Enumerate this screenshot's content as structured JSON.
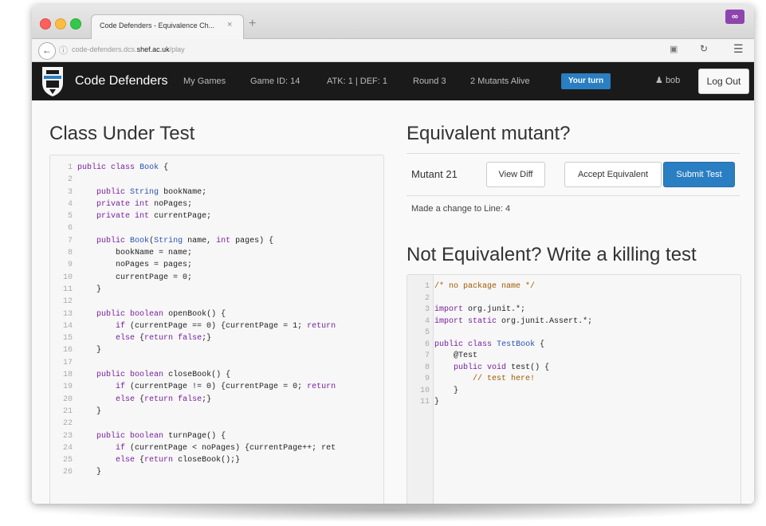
{
  "browser": {
    "tab_title": "Code Defenders - Equivalence Ch...",
    "tab_close": "×",
    "new_tab": "+",
    "ext_label": "∞",
    "url_prefix": "code-defenders.dcs.",
    "url_host": "shef.ac.uk",
    "url_path": "/play"
  },
  "navbar": {
    "brand": "Code Defenders",
    "my_games": "My Games",
    "game_id": "Game ID: 14",
    "score": "ATK: 1 | DEF: 1",
    "round": "Round 3",
    "mutants_alive": "2 Mutants Alive",
    "your_turn": "Your turn",
    "user": "bob",
    "logout": "Log Out"
  },
  "left": {
    "heading": "Class Under Test"
  },
  "right": {
    "heading": "Equivalent mutant?",
    "mutant": "Mutant 21",
    "view_diff": "View Diff",
    "accept_equivalent": "Accept Equivalent",
    "submit_test": "Submit Test",
    "change_text": "Made a change to Line: 4",
    "kill_heading": "Not Equivalent? Write a killing test"
  },
  "class_code": [
    "public class Book {",
    "",
    "    public String bookName;",
    "    private int noPages;",
    "    private int currentPage;",
    "",
    "    public Book(String name, int pages) {",
    "        bookName = name;",
    "        noPages = pages;",
    "        currentPage = 0;",
    "    }",
    "",
    "    public boolean openBook() {",
    "        if (currentPage == 0) {currentPage = 1; return",
    "        else {return false;}",
    "    }",
    "",
    "    public boolean closeBook() {",
    "        if (currentPage != 0) {currentPage = 0; return",
    "        else {return false;}",
    "    }",
    "",
    "    public boolean turnPage() {",
    "        if (currentPage < noPages) {currentPage++; ret",
    "        else {return closeBook();}",
    "    }"
  ],
  "test_code": [
    "/* no package name */",
    "",
    "import org.junit.*;",
    "import static org.junit.Assert.*;",
    "",
    "public class TestBook {",
    "    @Test",
    "    public void test() {",
    "        // test here!",
    "    }",
    "}"
  ],
  "colors": {
    "navbar_bg": "#1a1a1a",
    "primary": "#2a7ec2",
    "keyword": "#7a1fa0",
    "type": "#2a53b5",
    "comment": "#a05a00"
  }
}
